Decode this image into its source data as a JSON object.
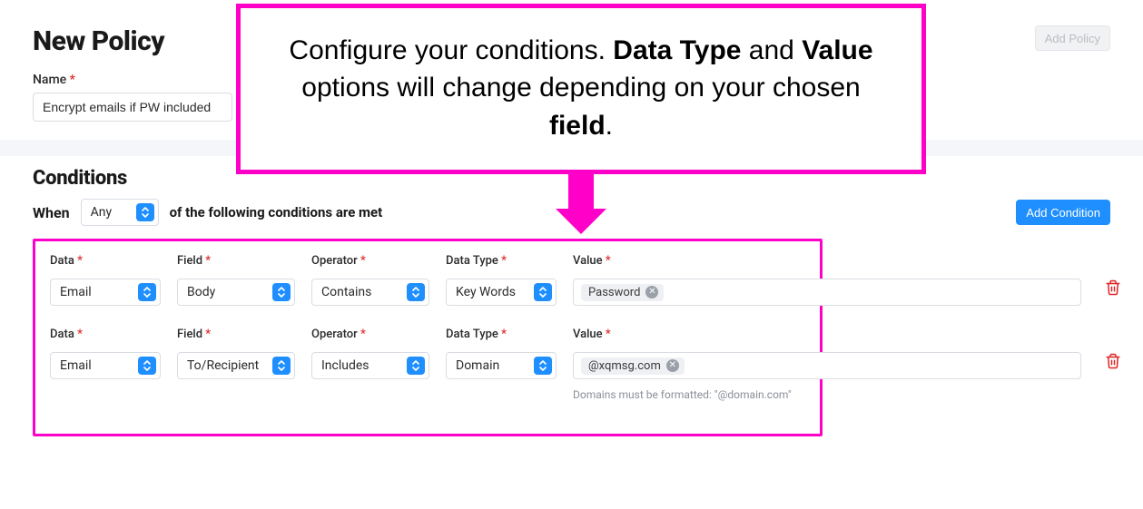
{
  "header": {
    "title": "New Policy",
    "add_policy_label": "Add Policy",
    "name_label": "Name",
    "name_value": "Encrypt emails if PW included"
  },
  "callout": {
    "text_prefix": "Configure your conditions. ",
    "bold1": "Data Type",
    "mid": " and ",
    "bold2": "Value",
    "text_mid2": " options will change depending on your chosen ",
    "bold3": "field",
    "suffix": "."
  },
  "conditions": {
    "heading": "Conditions",
    "when_label": "When",
    "when_select": "Any",
    "when_suffix": "of the following conditions are met",
    "add_condition_label": "Add Condition",
    "labels": {
      "data": "Data",
      "field": "Field",
      "operator": "Operator",
      "data_type": "Data Type",
      "value": "Value"
    },
    "rows": [
      {
        "data": "Email",
        "field": "Body",
        "operator": "Contains",
        "data_type": "Key Words",
        "value_tag": "Password",
        "helper": ""
      },
      {
        "data": "Email",
        "field": "To/Recipient",
        "operator": "Includes",
        "data_type": "Domain",
        "value_tag": "@xqmsg.com",
        "helper": "Domains must be formatted: \"@domain.com\""
      }
    ]
  }
}
